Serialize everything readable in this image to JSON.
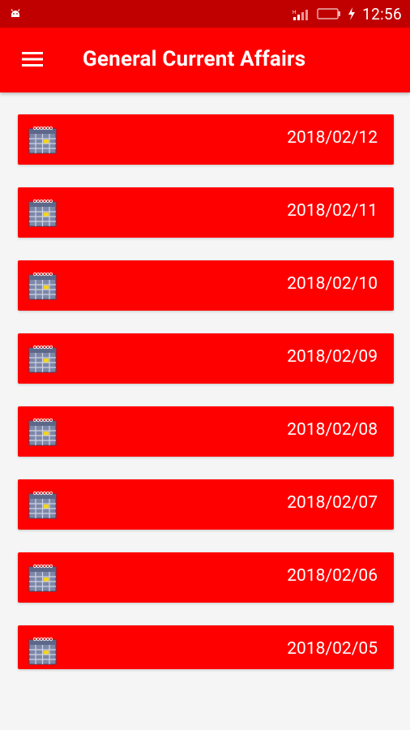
{
  "status_bar": {
    "time": "12:56",
    "icons": [
      "android-notification-icon",
      "signal-icon",
      "battery-icon",
      "charging-icon"
    ]
  },
  "app_bar": {
    "title": "General Current Affairs",
    "menu_icon": "hamburger-menu-icon"
  },
  "items": [
    {
      "date": "2018/02/12",
      "icon": "calendar-icon"
    },
    {
      "date": "2018/02/11",
      "icon": "calendar-icon"
    },
    {
      "date": "2018/02/10",
      "icon": "calendar-icon"
    },
    {
      "date": "2018/02/09",
      "icon": "calendar-icon"
    },
    {
      "date": "2018/02/08",
      "icon": "calendar-icon"
    },
    {
      "date": "2018/02/07",
      "icon": "calendar-icon"
    },
    {
      "date": "2018/02/06",
      "icon": "calendar-icon"
    },
    {
      "date": "2018/02/05",
      "icon": "calendar-icon"
    }
  ],
  "colors": {
    "status_bar": "#c00000",
    "app_bar": "#ff0000",
    "list_item": "#ff0000",
    "background": "#f5f5f5",
    "text": "#ffffff"
  }
}
